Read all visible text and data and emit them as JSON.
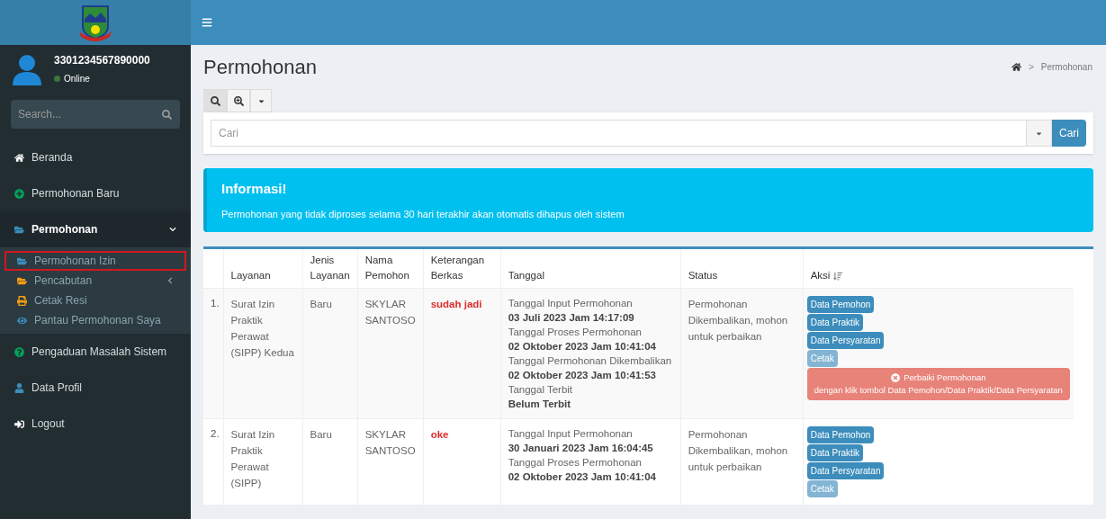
{
  "user": {
    "name": "3301234567890000",
    "status": "Online"
  },
  "sidebar_search": {
    "placeholder": "Search..."
  },
  "menu": [
    {
      "label": "Beranda",
      "expanded": false
    },
    {
      "label": "Permohonan Baru",
      "expanded": false
    },
    {
      "label": "Permohonan",
      "expanded": true,
      "children": [
        {
          "label": "Permohonan Izin",
          "selected": true,
          "has_submenu": false
        },
        {
          "label": "Pencabutan",
          "selected": false,
          "has_submenu": true
        },
        {
          "label": "Cetak Resi",
          "selected": false,
          "has_submenu": false
        },
        {
          "label": "Pantau Permohonan Saya",
          "selected": false,
          "has_submenu": false
        }
      ]
    },
    {
      "label": "Pengaduan Masalah Sistem",
      "expanded": false
    },
    {
      "label": "Data Profil",
      "expanded": false
    },
    {
      "label": "Logout",
      "expanded": false
    }
  ],
  "page_title": "Permohonan",
  "breadcrumb_separator": ">",
  "breadcrumb": [
    "Permohonan"
  ],
  "search_tabs": [
    {
      "selected": true
    },
    {
      "selected": false
    }
  ],
  "search": {
    "placeholder": "Cari",
    "button": "Cari"
  },
  "info": {
    "title": "Informasi!",
    "text": "Permohonan yang tidak diproses selama 30 hari terakhir akan otomatis dihapus oleh sistem"
  },
  "table": {
    "columns": [
      "Layanan",
      "Jenis Layanan",
      "Nama Pemohon",
      "Keterangan Berkas",
      "Tanggal",
      "Status",
      "Aksi"
    ],
    "rows": [
      {
        "no": "1.",
        "layanan": "Surat Izin Praktik Perawat (SIPP) Kedua",
        "jenis": "Baru",
        "nama": "SKYLAR SANTOSO",
        "keterangan": "sudah jadi",
        "tanggal": [
          {
            "label": "Tanggal Input Permohonan",
            "value": "03 Juli 2023 Jam 14:17:09"
          },
          {
            "label": "Tanggal Proses Permohonan",
            "value": "02 Oktober 2023 Jam 10:41:04"
          },
          {
            "label": "Tanggal Permohonan Dikembalikan",
            "value": "02 Oktober 2023 Jam 10:41:53"
          },
          {
            "label": "Tanggal Terbit",
            "value": "Belum Terbit"
          }
        ],
        "status": "Permohonan Dikembalikan, mohon untuk perbaikan",
        "actions": [
          {
            "label": "Data Pemohon",
            "disabled": false
          },
          {
            "label": "Data Praktik",
            "disabled": false
          },
          {
            "label": "Data Persyaratan",
            "disabled": false
          },
          {
            "label": "Cetak",
            "disabled": true
          }
        ],
        "alert": {
          "title": "Perbaiki Permohonan",
          "text": "dengan klik tombol Data Pemohon/Data Praktik/Data Persyaratan"
        }
      },
      {
        "no": "2.",
        "layanan": "Surat Izin Praktik Perawat (SIPP)",
        "jenis": "Baru",
        "nama": "SKYLAR SANTOSO",
        "keterangan": "oke",
        "tanggal": [
          {
            "label": "Tanggal Input Permohonan",
            "value": "30 Januari 2023 Jam 16:04:45"
          },
          {
            "label": "Tanggal Proses Permohonan",
            "value": "02 Oktober 2023 Jam 10:41:04"
          }
        ],
        "status": "Permohonan Dikembalikan, mohon untuk perbaikan",
        "actions": [
          {
            "label": "Data Pemohon",
            "disabled": false
          },
          {
            "label": "Data Praktik",
            "disabled": false
          },
          {
            "label": "Data Persyaratan",
            "disabled": false
          },
          {
            "label": "Cetak",
            "disabled": true
          }
        ]
      }
    ]
  }
}
